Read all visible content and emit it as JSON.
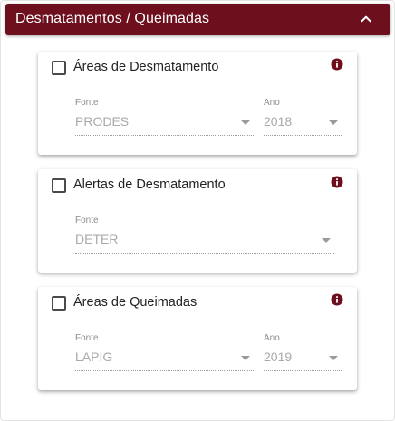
{
  "panel": {
    "title": "Desmatamentos / Queimadas",
    "header_color": "#6d0f1d",
    "collapse_icon": "chevron-up-icon"
  },
  "layers": [
    {
      "label": "Áreas de Desmatamento",
      "checked": false,
      "info_icon": "info-icon",
      "fonte": {
        "label": "Fonte",
        "value": "PRODES"
      },
      "ano": {
        "label": "Ano",
        "value": "2018"
      }
    },
    {
      "label": "Alertas de Desmatamento",
      "checked": false,
      "info_icon": "info-icon",
      "fonte": {
        "label": "Fonte",
        "value": "DETER"
      }
    },
    {
      "label": "Áreas de Queimadas",
      "checked": false,
      "info_icon": "info-icon",
      "fonte": {
        "label": "Fonte",
        "value": "LAPIG"
      },
      "ano": {
        "label": "Ano",
        "value": "2019"
      }
    }
  ],
  "colors": {
    "accent": "#6d0f1d",
    "muted_text": "#a9a9a9"
  }
}
